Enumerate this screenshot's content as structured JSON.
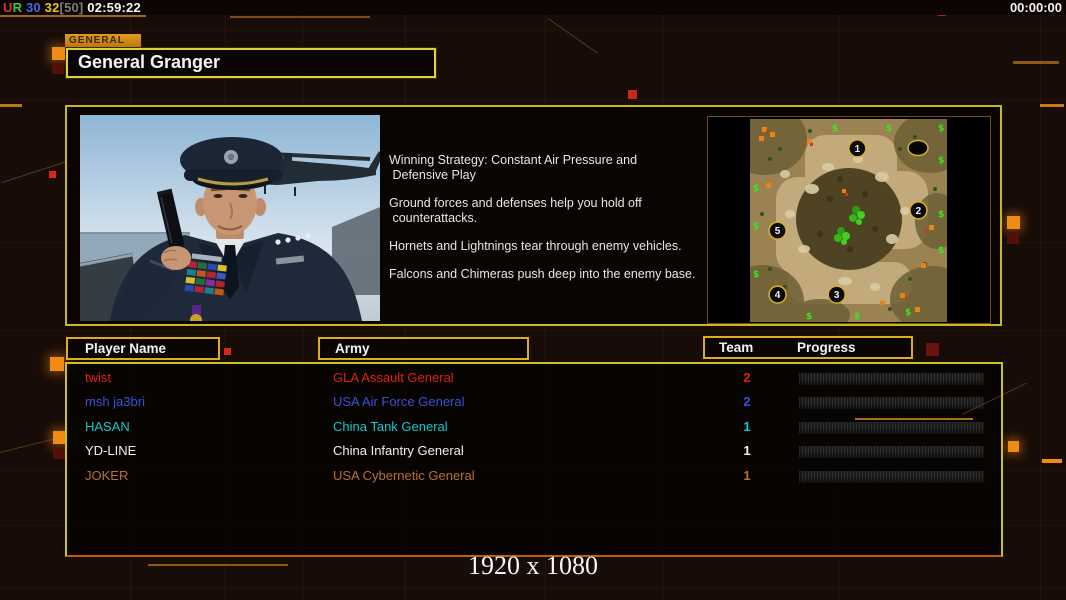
{
  "top_bar": {
    "left_parts": [
      {
        "text": "U",
        "color": "#e23322"
      },
      {
        "text": "R ",
        "color": "#3cc83c"
      },
      {
        "text": "30 ",
        "color": "#4a66de"
      },
      {
        "text": "32",
        "color": "#e6c61a"
      },
      {
        "text": "[50] ",
        "color": "#7d7d7d"
      },
      {
        "text": "02:59:22",
        "color": "#f4f4f4"
      }
    ],
    "right_time": "00:00:00"
  },
  "header": {
    "tab_label": "GENERAL",
    "title": "General Granger"
  },
  "briefing": {
    "paragraphs": [
      "Winning Strategy: Constant Air Pressure and\n Defensive Play",
      "Ground forces and defenses help you hold off\n counterattacks.",
      "Hornets and Lightnings tear through enemy vehicles.",
      "Falcons and Chimeras push deep into the enemy base."
    ]
  },
  "minimap": {
    "start_positions": [
      "1",
      "2",
      "3",
      "4",
      "5"
    ]
  },
  "players": {
    "columns": {
      "name": "Player Name",
      "army": "Army",
      "team": "Team",
      "progress": "Progress"
    },
    "rows": [
      {
        "name": "twist",
        "army": "GLA Assault General",
        "team": "2",
        "color": "#df2014"
      },
      {
        "name": "msh ja3bri",
        "army": "USA Air Force General",
        "team": "2",
        "color": "#3751dd"
      },
      {
        "name": "HASAN",
        "army": "China Tank General",
        "team": "1",
        "color": "#12c6cc"
      },
      {
        "name": "YD-LINE",
        "army": "China Infantry General",
        "team": "1",
        "color": "#f0f0f0"
      },
      {
        "name": "JOKER",
        "army": "USA Cybernetic General",
        "team": "1",
        "color": "#b56f35"
      }
    ]
  },
  "footer": {
    "resolution": "1920 x 1080"
  }
}
